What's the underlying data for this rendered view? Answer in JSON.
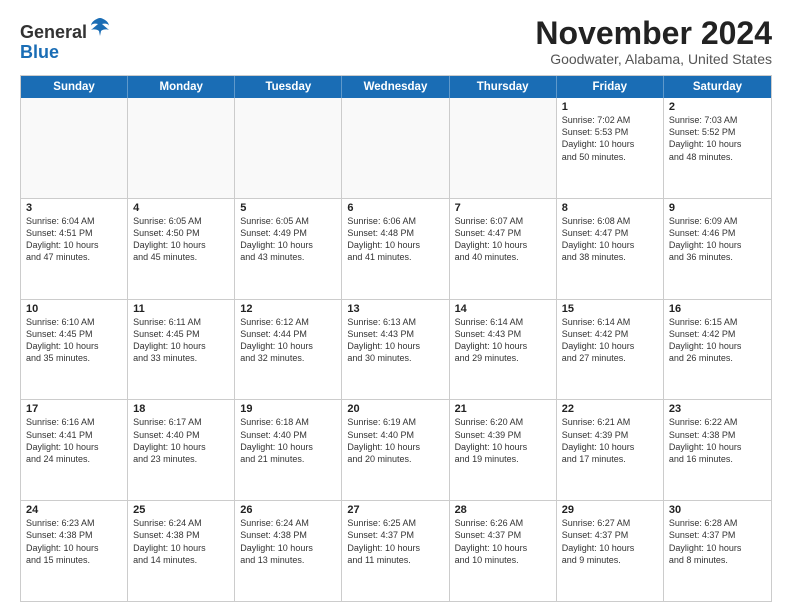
{
  "logo": {
    "general": "General",
    "blue": "Blue"
  },
  "header": {
    "month": "November 2024",
    "location": "Goodwater, Alabama, United States"
  },
  "weekdays": [
    "Sunday",
    "Monday",
    "Tuesday",
    "Wednesday",
    "Thursday",
    "Friday",
    "Saturday"
  ],
  "rows": [
    [
      {
        "day": "",
        "info": ""
      },
      {
        "day": "",
        "info": ""
      },
      {
        "day": "",
        "info": ""
      },
      {
        "day": "",
        "info": ""
      },
      {
        "day": "",
        "info": ""
      },
      {
        "day": "1",
        "info": "Sunrise: 7:02 AM\nSunset: 5:53 PM\nDaylight: 10 hours\nand 50 minutes."
      },
      {
        "day": "2",
        "info": "Sunrise: 7:03 AM\nSunset: 5:52 PM\nDaylight: 10 hours\nand 48 minutes."
      }
    ],
    [
      {
        "day": "3",
        "info": "Sunrise: 6:04 AM\nSunset: 4:51 PM\nDaylight: 10 hours\nand 47 minutes."
      },
      {
        "day": "4",
        "info": "Sunrise: 6:05 AM\nSunset: 4:50 PM\nDaylight: 10 hours\nand 45 minutes."
      },
      {
        "day": "5",
        "info": "Sunrise: 6:05 AM\nSunset: 4:49 PM\nDaylight: 10 hours\nand 43 minutes."
      },
      {
        "day": "6",
        "info": "Sunrise: 6:06 AM\nSunset: 4:48 PM\nDaylight: 10 hours\nand 41 minutes."
      },
      {
        "day": "7",
        "info": "Sunrise: 6:07 AM\nSunset: 4:47 PM\nDaylight: 10 hours\nand 40 minutes."
      },
      {
        "day": "8",
        "info": "Sunrise: 6:08 AM\nSunset: 4:47 PM\nDaylight: 10 hours\nand 38 minutes."
      },
      {
        "day": "9",
        "info": "Sunrise: 6:09 AM\nSunset: 4:46 PM\nDaylight: 10 hours\nand 36 minutes."
      }
    ],
    [
      {
        "day": "10",
        "info": "Sunrise: 6:10 AM\nSunset: 4:45 PM\nDaylight: 10 hours\nand 35 minutes."
      },
      {
        "day": "11",
        "info": "Sunrise: 6:11 AM\nSunset: 4:45 PM\nDaylight: 10 hours\nand 33 minutes."
      },
      {
        "day": "12",
        "info": "Sunrise: 6:12 AM\nSunset: 4:44 PM\nDaylight: 10 hours\nand 32 minutes."
      },
      {
        "day": "13",
        "info": "Sunrise: 6:13 AM\nSunset: 4:43 PM\nDaylight: 10 hours\nand 30 minutes."
      },
      {
        "day": "14",
        "info": "Sunrise: 6:14 AM\nSunset: 4:43 PM\nDaylight: 10 hours\nand 29 minutes."
      },
      {
        "day": "15",
        "info": "Sunrise: 6:14 AM\nSunset: 4:42 PM\nDaylight: 10 hours\nand 27 minutes."
      },
      {
        "day": "16",
        "info": "Sunrise: 6:15 AM\nSunset: 4:42 PM\nDaylight: 10 hours\nand 26 minutes."
      }
    ],
    [
      {
        "day": "17",
        "info": "Sunrise: 6:16 AM\nSunset: 4:41 PM\nDaylight: 10 hours\nand 24 minutes."
      },
      {
        "day": "18",
        "info": "Sunrise: 6:17 AM\nSunset: 4:40 PM\nDaylight: 10 hours\nand 23 minutes."
      },
      {
        "day": "19",
        "info": "Sunrise: 6:18 AM\nSunset: 4:40 PM\nDaylight: 10 hours\nand 21 minutes."
      },
      {
        "day": "20",
        "info": "Sunrise: 6:19 AM\nSunset: 4:40 PM\nDaylight: 10 hours\nand 20 minutes."
      },
      {
        "day": "21",
        "info": "Sunrise: 6:20 AM\nSunset: 4:39 PM\nDaylight: 10 hours\nand 19 minutes."
      },
      {
        "day": "22",
        "info": "Sunrise: 6:21 AM\nSunset: 4:39 PM\nDaylight: 10 hours\nand 17 minutes."
      },
      {
        "day": "23",
        "info": "Sunrise: 6:22 AM\nSunset: 4:38 PM\nDaylight: 10 hours\nand 16 minutes."
      }
    ],
    [
      {
        "day": "24",
        "info": "Sunrise: 6:23 AM\nSunset: 4:38 PM\nDaylight: 10 hours\nand 15 minutes."
      },
      {
        "day": "25",
        "info": "Sunrise: 6:24 AM\nSunset: 4:38 PM\nDaylight: 10 hours\nand 14 minutes."
      },
      {
        "day": "26",
        "info": "Sunrise: 6:24 AM\nSunset: 4:38 PM\nDaylight: 10 hours\nand 13 minutes."
      },
      {
        "day": "27",
        "info": "Sunrise: 6:25 AM\nSunset: 4:37 PM\nDaylight: 10 hours\nand 11 minutes."
      },
      {
        "day": "28",
        "info": "Sunrise: 6:26 AM\nSunset: 4:37 PM\nDaylight: 10 hours\nand 10 minutes."
      },
      {
        "day": "29",
        "info": "Sunrise: 6:27 AM\nSunset: 4:37 PM\nDaylight: 10 hours\nand 9 minutes."
      },
      {
        "day": "30",
        "info": "Sunrise: 6:28 AM\nSunset: 4:37 PM\nDaylight: 10 hours\nand 8 minutes."
      }
    ]
  ]
}
